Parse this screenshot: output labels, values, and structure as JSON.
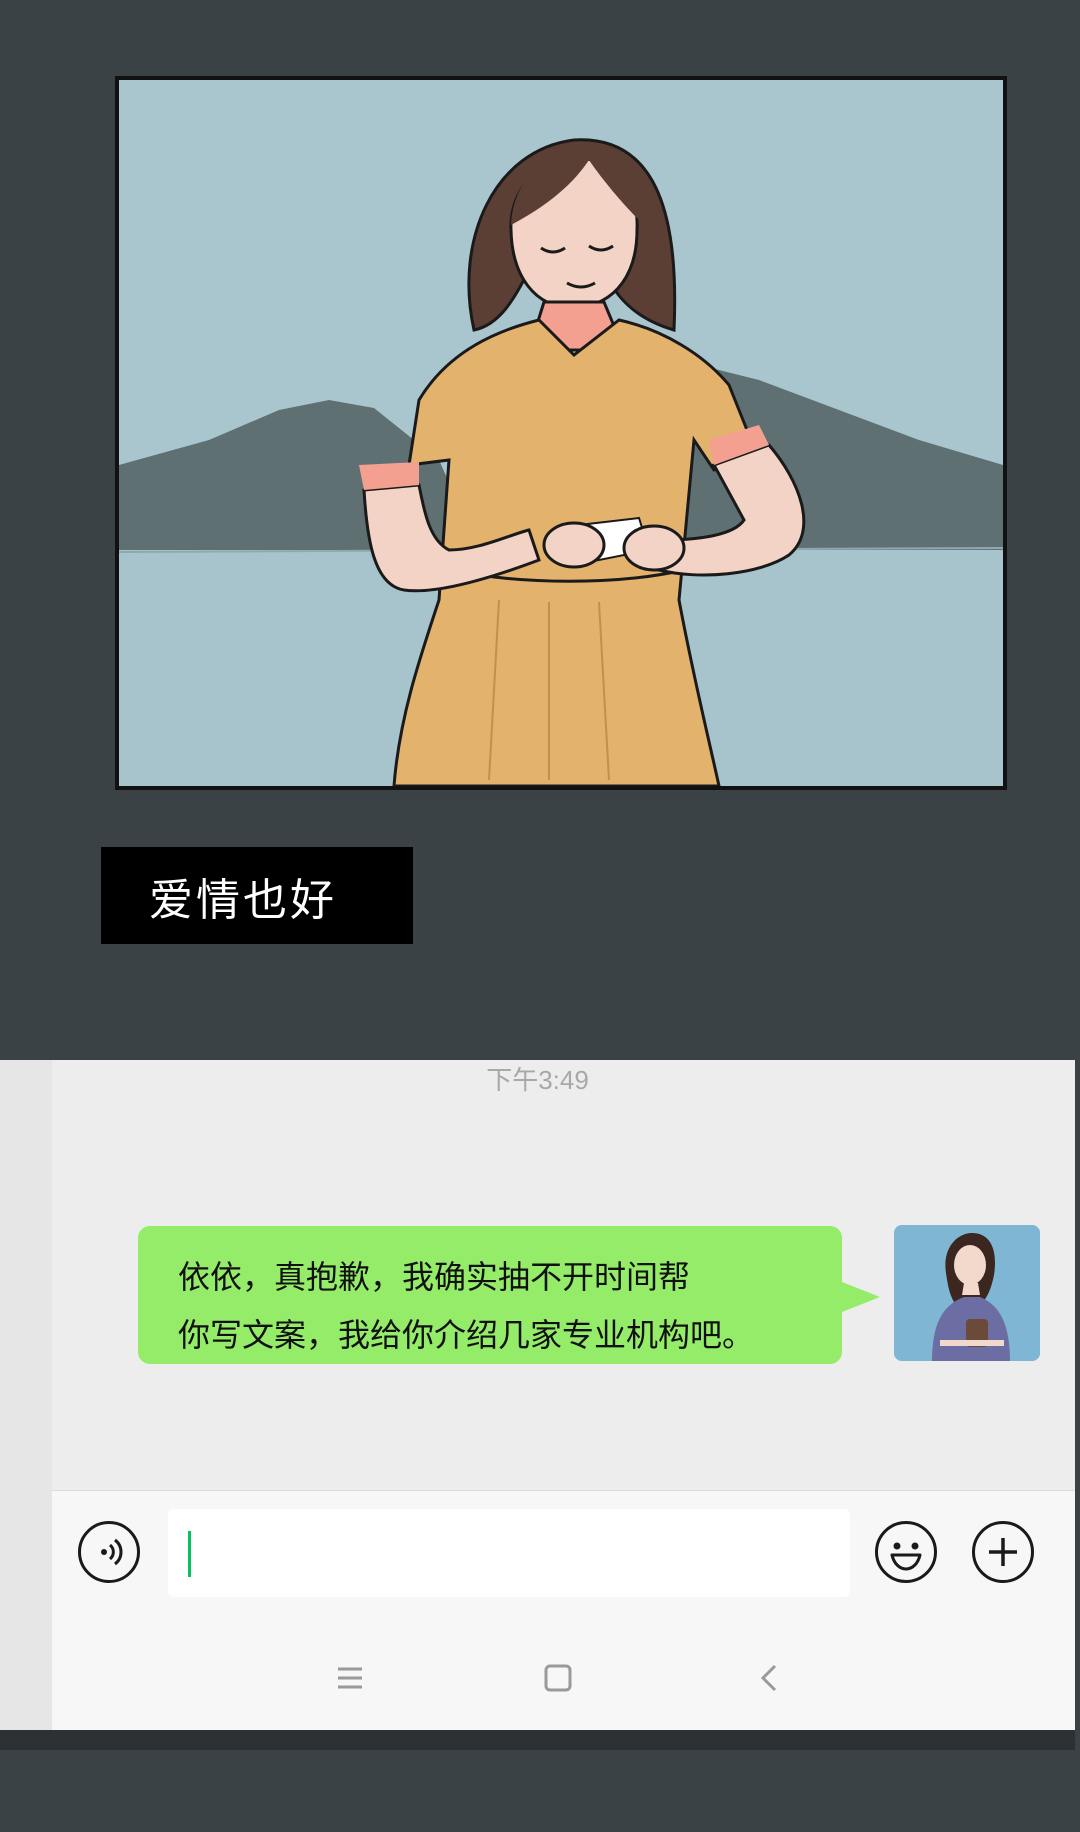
{
  "caption": {
    "text": "爱情也好"
  },
  "chat": {
    "timestamp": "下午3:49",
    "message": {
      "line1": "依依，真抱歉，我确实抽不开时间帮",
      "line2": "你写文案，我给你介绍几家专业机构吧。",
      "bubble_color": "#95ec69"
    },
    "input": {
      "value": "",
      "caret_color": "#07c160"
    },
    "icons": {
      "voice": "voice-icon",
      "emoji": "emoji-icon",
      "more": "plus-icon"
    }
  },
  "nav": {
    "icons": [
      "menu-icon",
      "home-icon",
      "back-icon"
    ]
  },
  "colors": {
    "page_background": "#3a4245",
    "sky": "#a9c6cf",
    "mountain": "#5f7073",
    "dress": "#e3b26d",
    "hair": "#5b3f35",
    "skin": "#f3d3c5",
    "chat_background": "#ededed"
  }
}
